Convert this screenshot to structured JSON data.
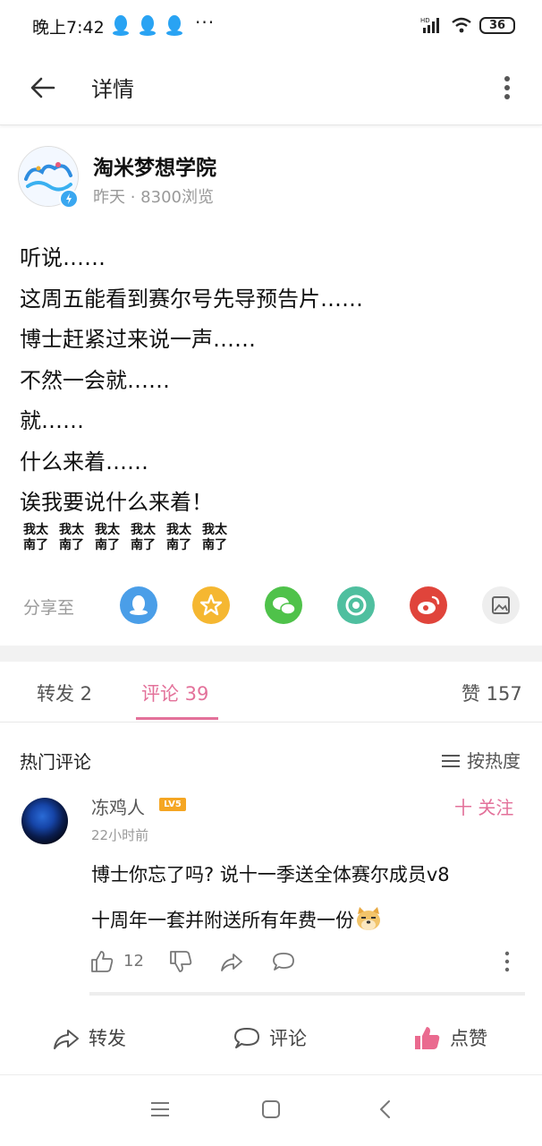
{
  "status_bar": {
    "time": "晚上7:42",
    "dots": "···",
    "battery": "36",
    "network_label": "HD"
  },
  "header": {
    "title": "详情"
  },
  "author": {
    "name": "淘米梦想学院",
    "meta": "昨天 · 8300浏览"
  },
  "post": {
    "lines": [
      "听说……",
      "这周五能看到赛尔号先导预告片……",
      "博士赶紧过来说一声……",
      "不然一会就……",
      "就……",
      "什么来着……",
      "诶我要说什么来着！"
    ],
    "stickers": [
      {
        "top": "我太",
        "bottom": "南了"
      },
      {
        "top": "我太",
        "bottom": "南了"
      },
      {
        "top": "我太",
        "bottom": "南了"
      },
      {
        "top": "我太",
        "bottom": "南了"
      },
      {
        "top": "我太",
        "bottom": "南了"
      },
      {
        "top": "我太",
        "bottom": "南了"
      }
    ]
  },
  "share": {
    "label": "分享至",
    "targets": [
      {
        "name": "QQ",
        "icon": "qq-icon",
        "color": "#4a9ee8"
      },
      {
        "name": "QQ空间",
        "icon": "qzone-icon",
        "color": "#f5b731"
      },
      {
        "name": "微信",
        "icon": "wechat-icon",
        "color": "#4fc24a"
      },
      {
        "name": "朋友圈",
        "icon": "moments-icon",
        "color": "#4fbf9f"
      },
      {
        "name": "微博",
        "icon": "weibo-icon",
        "color": "#e0443b"
      },
      {
        "name": "图片",
        "icon": "image-icon",
        "color": "#eeeeee"
      }
    ]
  },
  "tabs": {
    "repost": "转发 2",
    "comments": "评论 39",
    "likes": "赞 157"
  },
  "comments_section": {
    "title": "热门评论",
    "sort_label": "按热度"
  },
  "comment": {
    "user": "冻鸡人",
    "level_badge": "LV5",
    "follow_label": "十 关注",
    "time": "22小时前",
    "text_line1": "博士你忘了吗? 说十一季送全体赛尔成员v8",
    "text_line2": "十周年一套并附送所有年费一份",
    "like_count": "12"
  },
  "action_bar": {
    "repost": "转发",
    "comment": "评论",
    "like": "点赞"
  },
  "colors": {
    "accent_pink": "#e3719a",
    "level_badge": "#f5a623"
  }
}
